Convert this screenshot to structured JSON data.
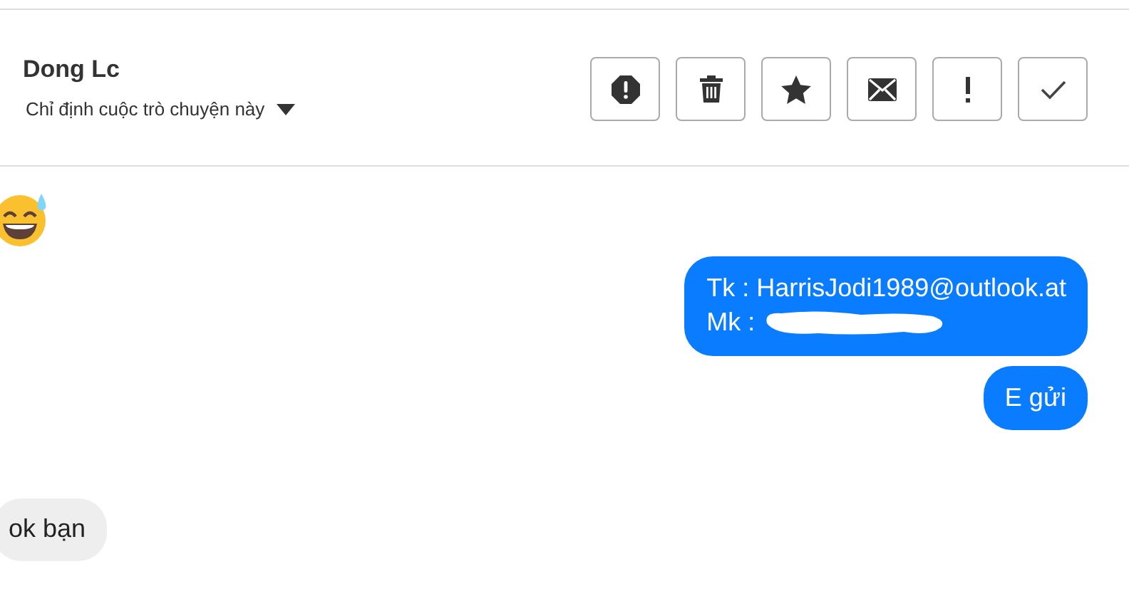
{
  "header": {
    "name": "Dong Lc",
    "subtitle": "Chỉ định cuộc trò chuyện này"
  },
  "actions": [
    {
      "kind": "alert"
    },
    {
      "kind": "trash"
    },
    {
      "kind": "star"
    },
    {
      "kind": "mail"
    },
    {
      "kind": "exclaim"
    },
    {
      "kind": "check"
    }
  ],
  "messages": [
    {
      "kind": "emoji"
    },
    {
      "kind": "outgoing",
      "lines": [
        {
          "text": "Tk : HarrisJodi1989@outlook.at",
          "redacted": false
        },
        {
          "text": "Mk :",
          "redacted": true
        }
      ]
    },
    {
      "kind": "outgoing",
      "lines": [
        {
          "text": "E gửi",
          "redacted": false
        }
      ]
    },
    {
      "kind": "incoming",
      "lines": [
        {
          "text": "ok bạn"
        }
      ]
    }
  ]
}
